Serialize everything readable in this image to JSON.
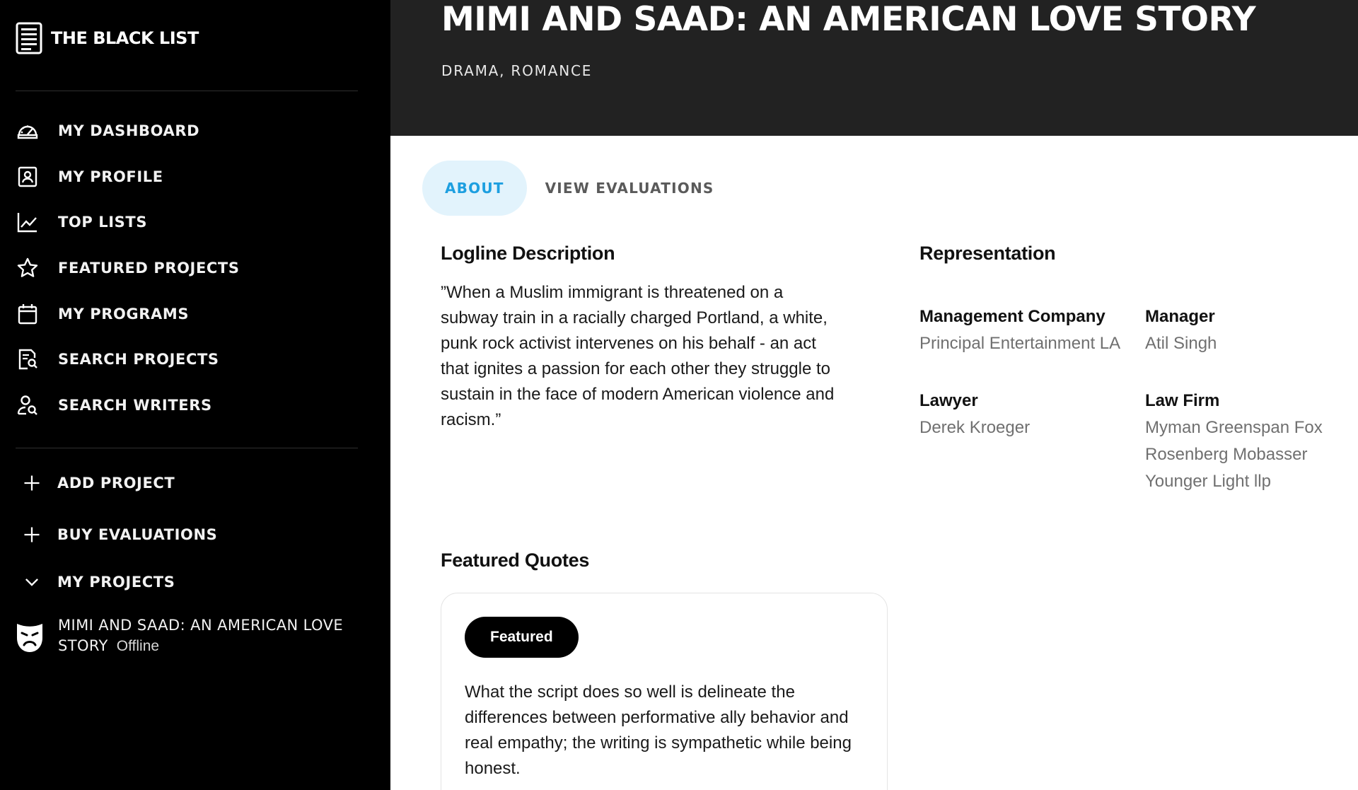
{
  "app": {
    "name": "THE BLACK LIST"
  },
  "sidebar": {
    "items": [
      {
        "label": "MY DASHBOARD",
        "icon": "dashboard-gauge-icon"
      },
      {
        "label": "MY PROFILE",
        "icon": "profile-card-icon"
      },
      {
        "label": "TOP LISTS",
        "icon": "line-chart-icon"
      },
      {
        "label": "FEATURED PROJECTS",
        "icon": "star-icon"
      },
      {
        "label": "MY PROGRAMS",
        "icon": "calendar-icon"
      },
      {
        "label": "SEARCH PROJECTS",
        "icon": "document-search-icon"
      },
      {
        "label": "SEARCH WRITERS",
        "icon": "user-search-icon"
      }
    ],
    "actions": [
      {
        "label": "ADD PROJECT",
        "icon": "plus-icon"
      },
      {
        "label": "BUY EVALUATIONS",
        "icon": "plus-icon"
      },
      {
        "label": "MY PROJECTS",
        "icon": "chevron-down-icon"
      }
    ],
    "project": {
      "title": "MIMI AND SAAD: AN AMERICAN LOVE STORY",
      "status": "Offline",
      "icon": "drama-mask-icon"
    }
  },
  "header": {
    "title": "MIMI AND SAAD: AN AMERICAN LOVE STORY",
    "genre": "DRAMA, ROMANCE"
  },
  "tabs": [
    {
      "label": "ABOUT",
      "active": true
    },
    {
      "label": "VIEW EVALUATIONS",
      "active": false
    }
  ],
  "logline": {
    "heading": "Logline Description",
    "text": "”When a Muslim immigrant is threatened on a subway train in a racially charged Portland, a white, punk rock activist intervenes on his behalf - an act that ignites a passion for each other they struggle to sustain in the face of modern American violence and racism.”"
  },
  "representation": {
    "heading": "Representation",
    "management_company_label": "Management Company",
    "management_company": "Principal Entertainment LA",
    "manager_label": "Manager",
    "manager": "Atil Singh",
    "lawyer_label": "Lawyer",
    "lawyer": "Derek Kroeger",
    "law_firm_label": "Law Firm",
    "law_firm": "Myman Greenspan Fox Rosenberg Mobasser Younger Light llp"
  },
  "quotes": {
    "heading": "Featured Quotes",
    "badge": "Featured",
    "text": "What the script does so well is delineate the differences between performative ally behavior and real empathy; the writing is sympathetic while being honest."
  },
  "colors": {
    "sidebar_bg": "#000000",
    "header_bg": "#222222",
    "accent": "#1d9fe0",
    "active_tab_bg": "#e2f3fc",
    "muted_text": "#707070"
  }
}
